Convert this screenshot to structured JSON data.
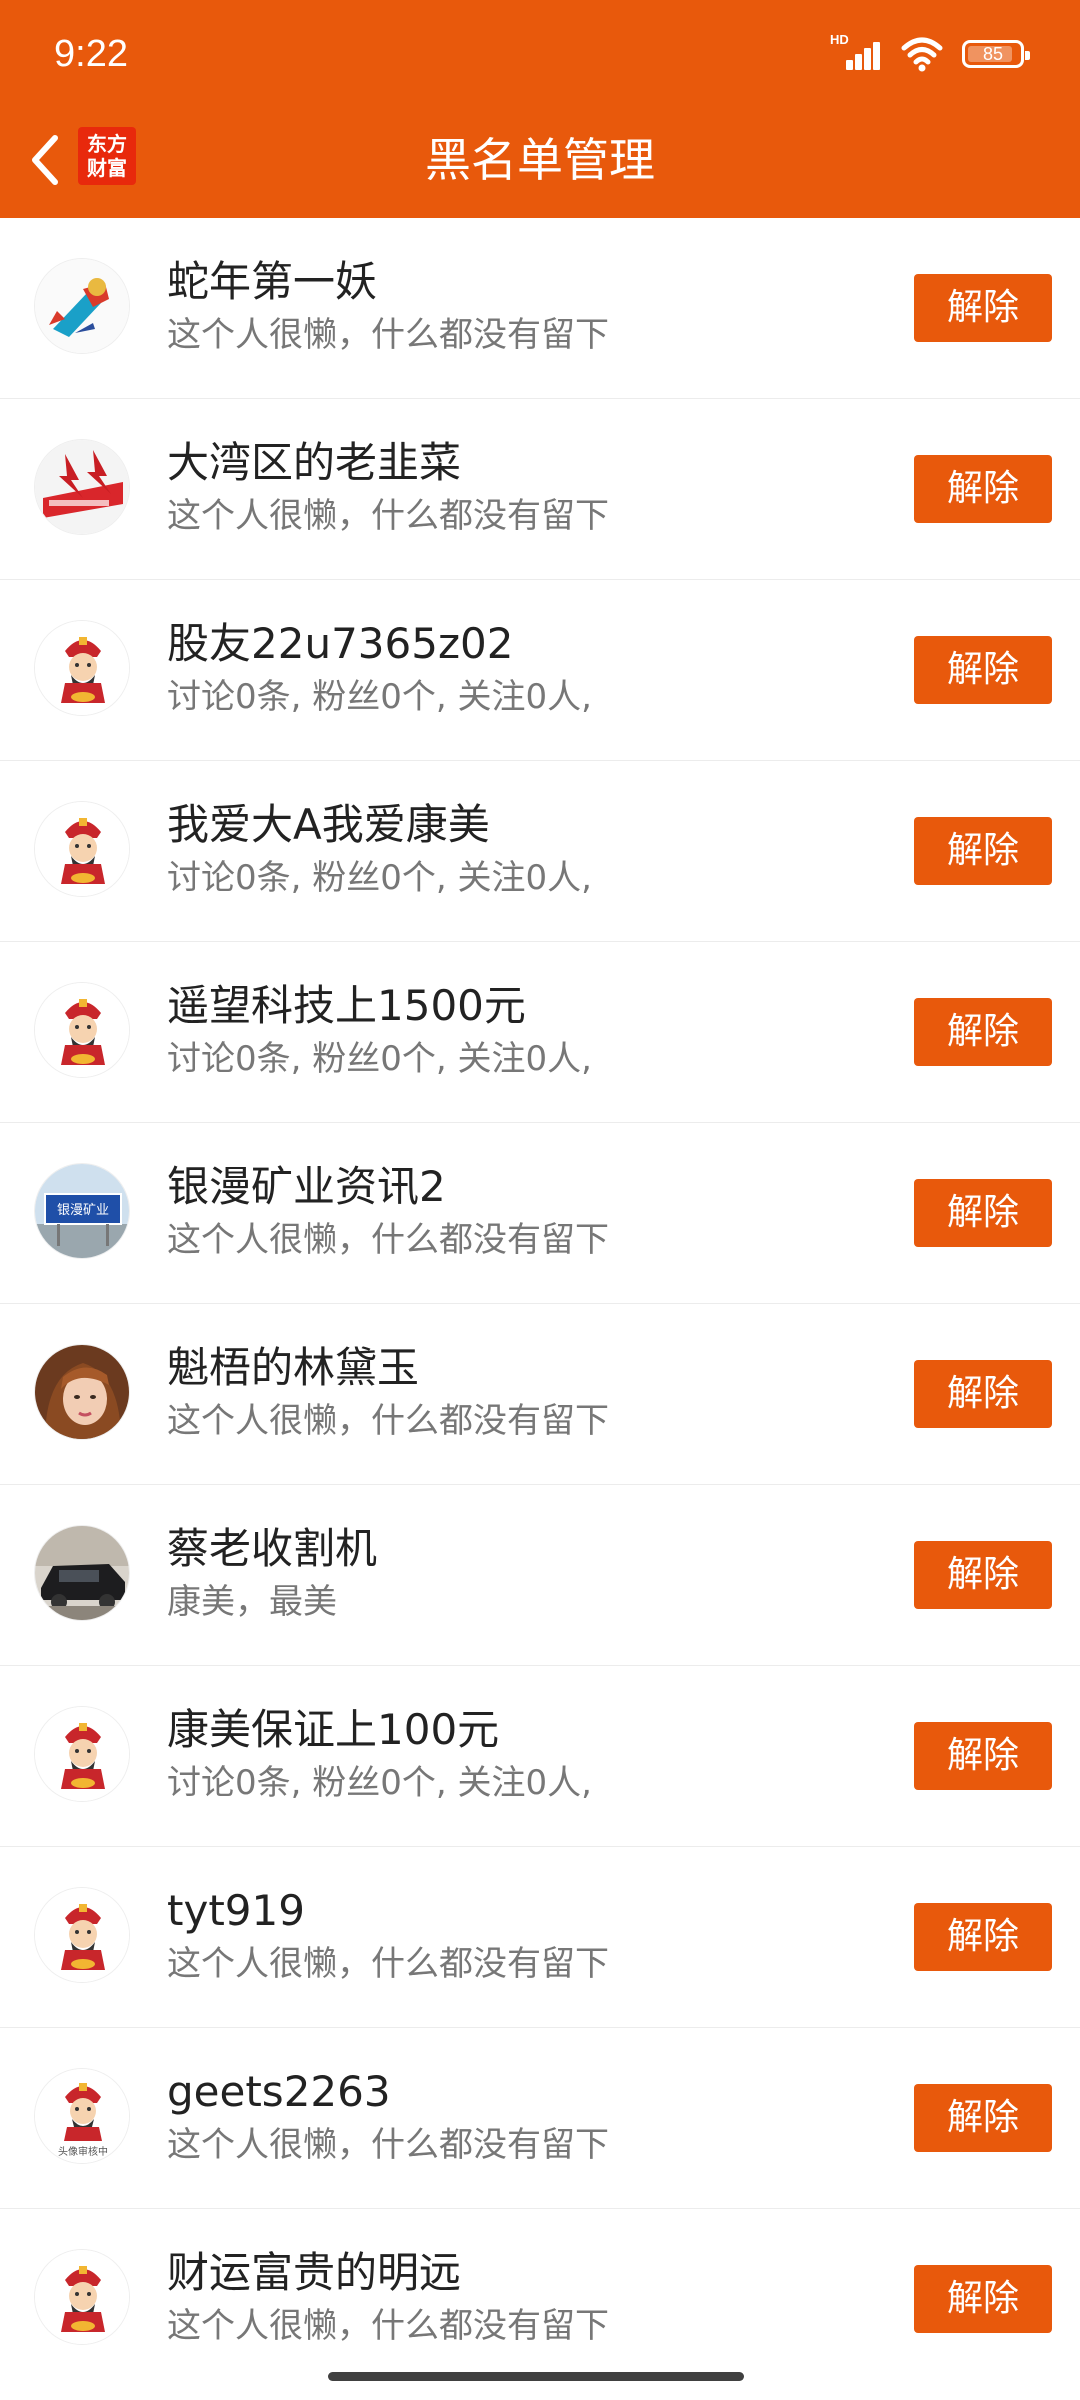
{
  "status_bar": {
    "time": "9:22",
    "network_badge": "HD",
    "battery_level": "85",
    "icons": [
      "signal-icon",
      "wifi-icon",
      "battery-icon"
    ]
  },
  "header": {
    "title": "黑名单管理",
    "logo_line1": "东方",
    "logo_line2": "财富",
    "accent_color": "#E8590C"
  },
  "blacklist": [
    {
      "name": "蛇年第一妖",
      "desc": "这个人很懒，什么都没有留下",
      "button": "解除",
      "avatar": "superhero-avatar"
    },
    {
      "name": "大湾区的老韭菜",
      "desc": "这个人很懒，什么都没有留下",
      "button": "解除",
      "avatar": "red-logo-avatar"
    },
    {
      "name": "股友22u7365z02",
      "desc": "讨论0条, 粉丝0个, 关注0人,",
      "button": "解除",
      "avatar": "default-fortune-avatar"
    },
    {
      "name": "我爱大A我爱康美",
      "desc": "讨论0条, 粉丝0个, 关注0人,",
      "button": "解除",
      "avatar": "default-fortune-avatar"
    },
    {
      "name": "遥望科技上1500元",
      "desc": "讨论0条, 粉丝0个, 关注0人,",
      "button": "解除",
      "avatar": "default-fortune-avatar"
    },
    {
      "name": "银漫矿业资讯2",
      "desc": "这个人很懒，什么都没有留下",
      "button": "解除",
      "avatar": "road-sign-avatar"
    },
    {
      "name": "魁梧的林黛玉",
      "desc": "这个人很懒，什么都没有留下",
      "button": "解除",
      "avatar": "portrait-avatar"
    },
    {
      "name": "蔡老收割机",
      "desc": "康美，最美",
      "button": "解除",
      "avatar": "car-avatar"
    },
    {
      "name": "康美保证上100元",
      "desc": "讨论0条, 粉丝0个, 关注0人,",
      "button": "解除",
      "avatar": "default-fortune-avatar"
    },
    {
      "name": "tyt919",
      "desc": "这个人很懒，什么都没有留下",
      "button": "解除",
      "avatar": "default-fortune-avatar"
    },
    {
      "name": "geets2263",
      "desc": "这个人很懒，什么都没有留下",
      "button": "解除",
      "avatar": "default-fortune-avatar",
      "avatar_caption": "头像审核中"
    },
    {
      "name": "财运富贵的明远",
      "desc": "这个人很懒，什么都没有留下",
      "button": "解除",
      "avatar": "default-fortune-avatar"
    }
  ],
  "road_sign_text": "银漫矿业"
}
